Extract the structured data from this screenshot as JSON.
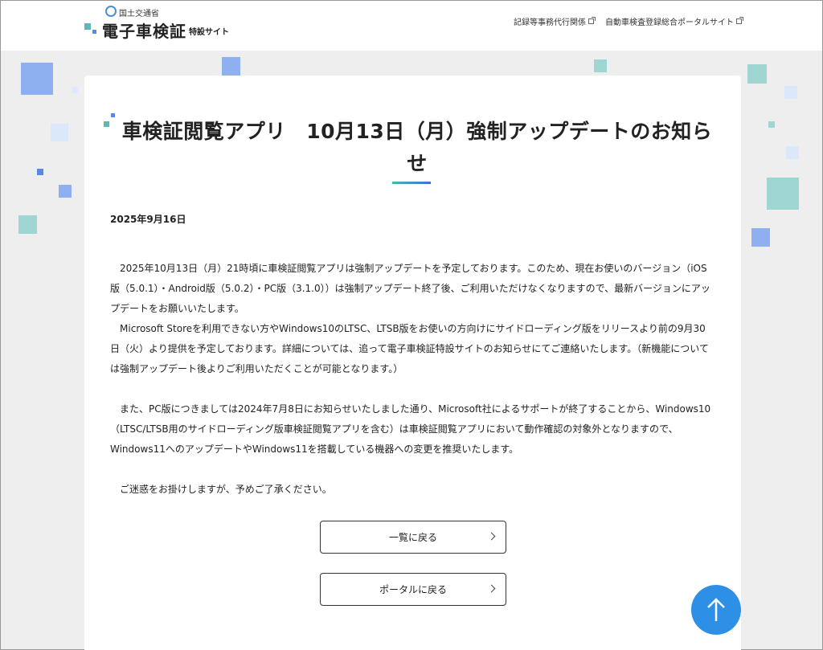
{
  "header": {
    "ministry": "国土交通省",
    "site_name": "電子車検証",
    "site_sub": "特設サイト",
    "links": [
      {
        "label": "記録等事務代行関係"
      },
      {
        "label": "自動車検査登録総合ポータルサイト"
      }
    ]
  },
  "article": {
    "title": "車検証閲覧アプリ　10月13日（月）強制アップデートのお知らせ",
    "date": "2025年9月16日",
    "paragraphs": [
      "　2025年10月13日（月）21時頃に車検証閲覧アプリは強制アップデートを予定しております。このため、現在お使いのバージョン（iOS版（5.0.1）・Android版（5.0.2）・PC版（3.1.0））は強制アップデート終了後、ご利用いただけなくなりますので、最新バージョンにアップデートをお願いいたします。",
      "　Microsoft Storeを利用できない方やWindows10のLTSC、LTSB版をお使いの方向けにサイドローディング版をリリースより前の9月30日（火）より提供を予定しております。詳細については、追って電子車検証特設サイトのお知らせにてご連絡いたします。（新機能については強制アップデート後よりご利用いただくことが可能となります。）",
      "　また、PC版につきましては2024年7月8日にお知らせいたしました通り、Microsoft社によるサポートが終了することから、Windows10（LTSC/LTSB用のサイドローディング版車検証閲覧アプリを含む）は車検証閲覧アプリにおいて動作確認の対象外となりますので、Windows11へのアップデートやWindows11を搭載している機器への変更を推奨いたします。",
      "　ご迷惑をお掛けしますが、予めご了承ください。"
    ]
  },
  "buttons": {
    "back_to_list": "一覧に戻る",
    "back_to_portal": "ポータルに戻る"
  },
  "colors": {
    "accent_teal": "#5db9b6",
    "accent_blue": "#5b87e6",
    "to_top": "#2d8fe6"
  }
}
